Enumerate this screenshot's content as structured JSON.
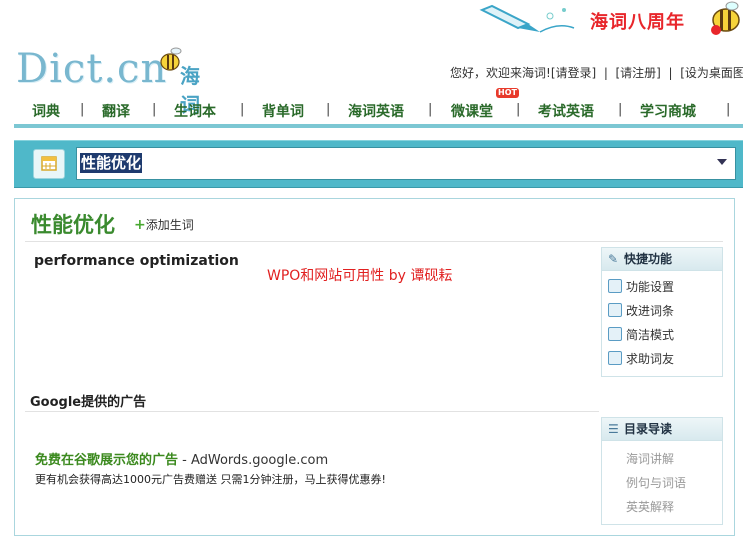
{
  "banner": {
    "anniversary": "海词八周年"
  },
  "logo": {
    "text": "Dict.cn",
    "suffix": "海词"
  },
  "account": {
    "greeting": "您好，欢迎来海词!",
    "login": "[请登录]",
    "register": "[请注册]",
    "set_desktop": "[设为桌面图"
  },
  "nav": {
    "items": [
      "词典",
      "翻译",
      "生词本",
      "背单词",
      "海词英语",
      "微课堂",
      "考试英语",
      "学习商城"
    ],
    "hot_badge": "HOT"
  },
  "search": {
    "query": "性能优化"
  },
  "entry": {
    "word": "性能优化",
    "add_word": "添加生词",
    "translation": "performance optimization",
    "watermark": "WPO和网站可用性 by 谭砚耘"
  },
  "quick_panel": {
    "title": "快捷功能",
    "items": [
      {
        "label": "功能设置",
        "icon": "gear-icon"
      },
      {
        "label": "改进词条",
        "icon": "edit-icon"
      },
      {
        "label": "简洁模式",
        "icon": "document-icon"
      },
      {
        "label": "求助词友",
        "icon": "help-bubble-icon"
      }
    ]
  },
  "ads": {
    "title": "Google提供的广告",
    "headline": "免费在谷歌展示您的广告",
    "url": " - AdWords.google.com",
    "description": "更有机会获得高达1000元广告费赠送 只需1分钟注册，马上获得优惠券!"
  },
  "toc_panel": {
    "title": "目录导读",
    "items": [
      "海词讲解",
      "例句与词语",
      "英英解释"
    ]
  },
  "colors": {
    "brand_green": "#3a8a2e",
    "search_bar": "#4fb8c9",
    "anniversary_red": "#e8262b"
  }
}
